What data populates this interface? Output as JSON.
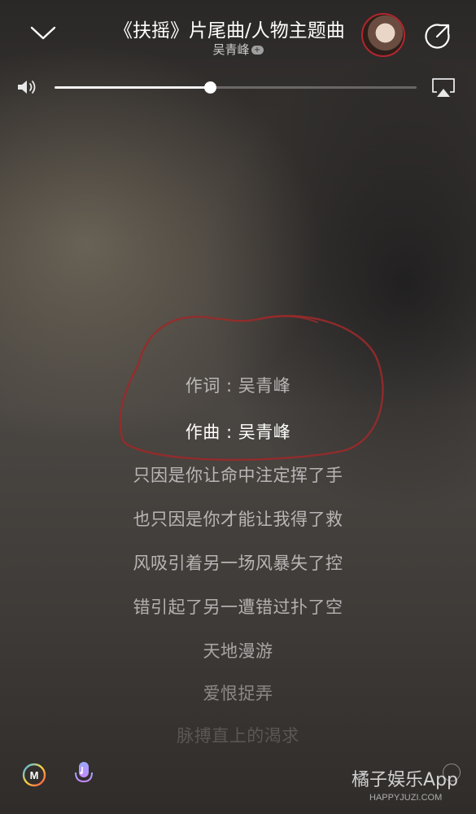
{
  "header": {
    "title": "《扶摇》片尾曲/人物主题曲",
    "artist": "吴青峰",
    "artist_badge": "+"
  },
  "volume": {
    "level": 0.43
  },
  "lyrics": [
    "作词 : 吴青峰",
    "作曲 : 吴青峰",
    "只因是你让命中注定挥了手",
    "也只因是你才能让我得了救",
    "风吸引着另一场风暴失了控",
    "错引起了另一遭错过扑了空",
    "天地漫游",
    "爱恨捉弄",
    "脉搏直上的渴求"
  ],
  "current_lyric_index": 1,
  "watermark": {
    "brand": "橘子娱乐App",
    "url": "HAPPYJUZI.COM"
  },
  "colors": {
    "annotation": "#9a2a2a",
    "cover_ring": "#b3262e"
  },
  "icons": {
    "down": "chevron-down-icon",
    "share": "share-icon",
    "volume": "speaker-icon",
    "airplay": "airplay-icon",
    "m": "m-logo-icon",
    "mic": "microphone-icon"
  }
}
